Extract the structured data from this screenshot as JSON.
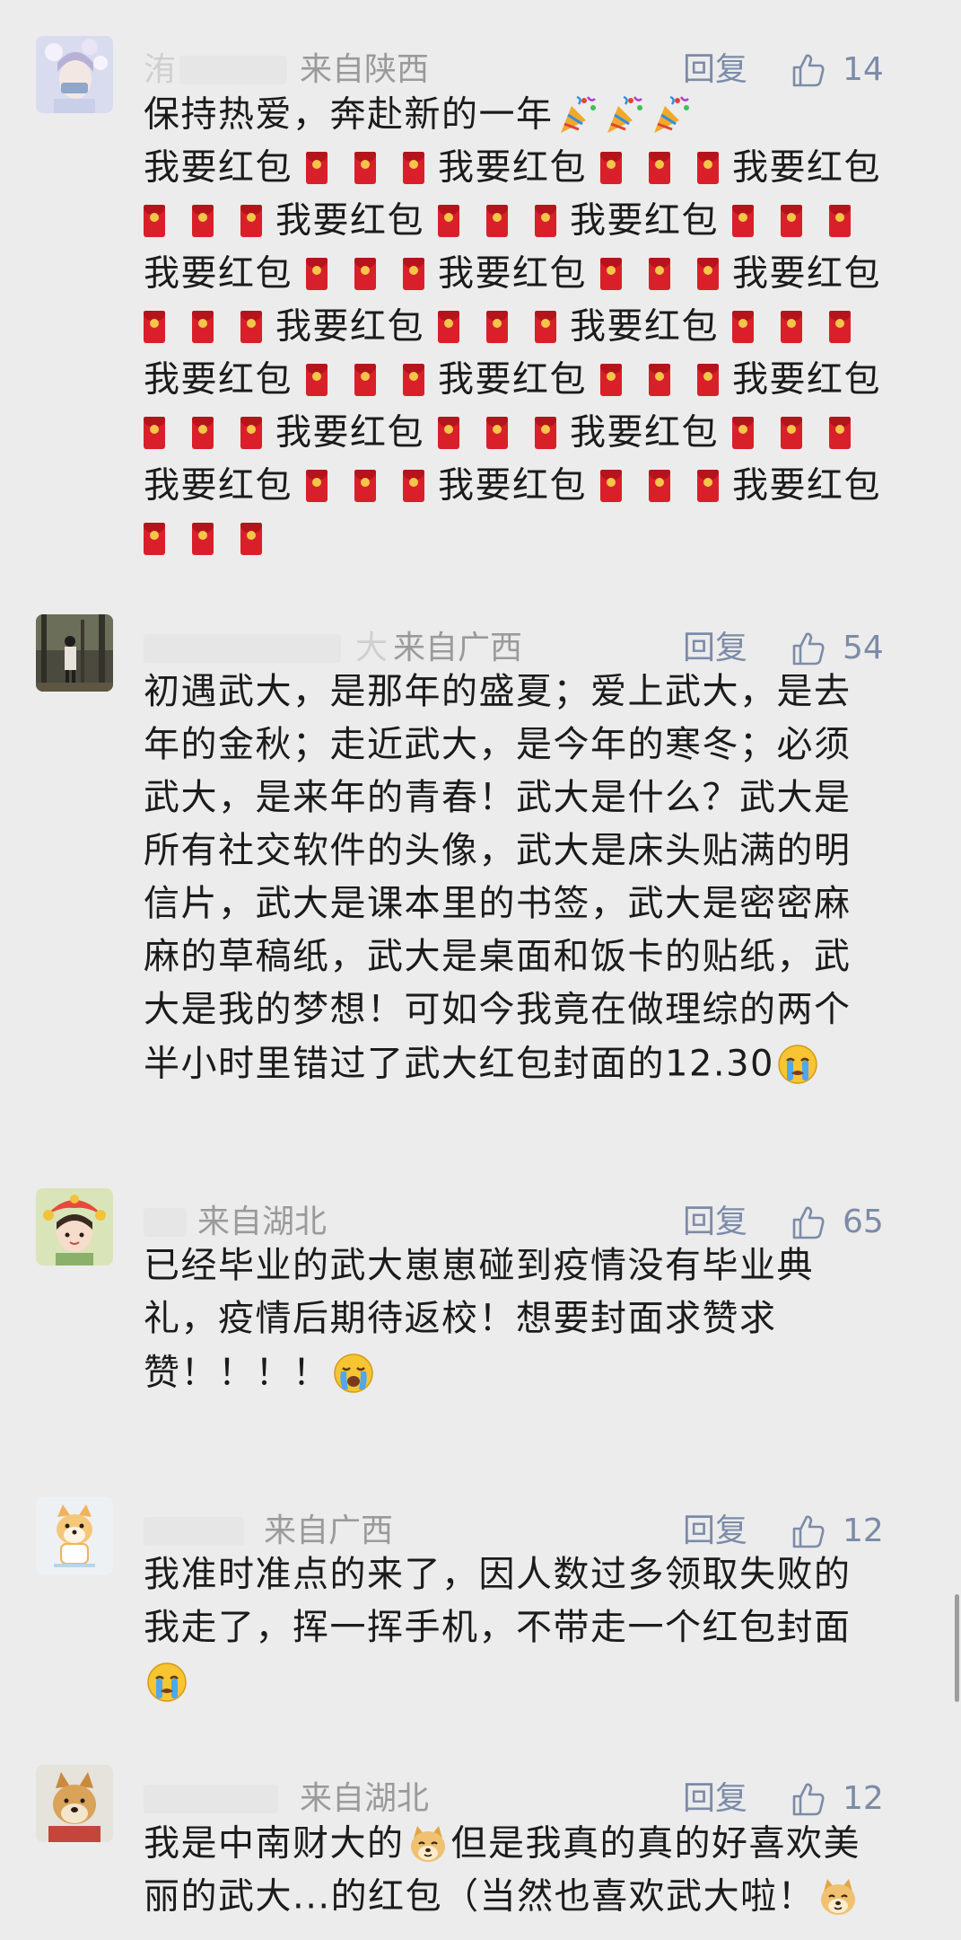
{
  "comments": [
    {
      "location": "来自陕西",
      "reply_label": "回复",
      "likes": "14",
      "name_hint": "洧",
      "intro": "保持热爱，奔赴新的一年",
      "refrain": "我要红包"
    },
    {
      "location": "来自广西",
      "reply_label": "回复",
      "likes": "54",
      "name_hint": "大",
      "lines": [
        "初遇武大，是那年的盛夏；爱上武大，是去",
        "年的金秋；走近武大，是今年的寒冬；必须",
        "武大，是来年的青春！武大是什么？武大是",
        "所有社交软件的头像，武大是床头贴满的明",
        "信片，武大是课本里的书签，武大是密密麻",
        "麻的草稿纸，武大是桌面和饭卡的贴纸，武",
        "大是我的梦想！可如今我竟在做理综的两个",
        "半小时里错过了武大红包封面的12.30"
      ]
    },
    {
      "location": "来自湖北",
      "reply_label": "回复",
      "likes": "65",
      "lines": [
        "已经毕业的武大崽崽碰到疫情没有毕业典",
        "礼，疫情后期待返校！想要封面求赞求",
        "赞！！！！"
      ]
    },
    {
      "location": "来自广西",
      "reply_label": "回复",
      "likes": "12",
      "lines": [
        "我准时准点的来了，因人数过多领取失败的",
        "我走了，挥一挥手机，不带走一个红包封面"
      ]
    },
    {
      "location": "来自湖北",
      "reply_label": "回复",
      "likes": "12",
      "line1_a": "我是中南财大的",
      "line1_b": "但是我真的真的好喜欢美",
      "line2": "丽的武大...的红包（当然也喜欢武大啦！"
    }
  ]
}
